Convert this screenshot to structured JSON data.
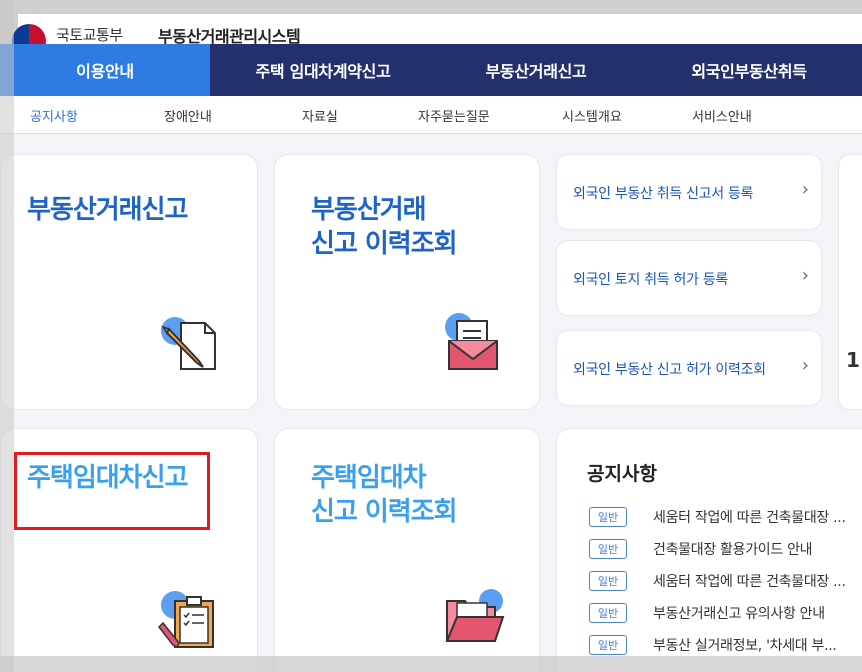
{
  "header": {
    "ministry": "국토교통부",
    "system_name": "부동산거래관리시스템"
  },
  "main_nav": [
    {
      "label": "이용안내",
      "active": true
    },
    {
      "label": "주택 임대차계약신고",
      "active": false
    },
    {
      "label": "부동산거래신고",
      "active": false
    },
    {
      "label": "외국인부동산취득",
      "active": false
    }
  ],
  "sub_nav": [
    {
      "label": "공지사항",
      "active": true
    },
    {
      "label": "장애안내",
      "active": false
    },
    {
      "label": "자료실",
      "active": false
    },
    {
      "label": "자주묻는질문",
      "active": false
    },
    {
      "label": "시스템개요",
      "active": false
    },
    {
      "label": "서비스안내",
      "active": false
    }
  ],
  "cards": {
    "real_estate_report": {
      "title": "부동산거래신고",
      "icon": "document-pencil-icon"
    },
    "real_estate_history": {
      "title": "부동산거래\n신고 이력조회",
      "icon": "mail-document-icon"
    },
    "housing_lease_report": {
      "title": "주택임대차신고",
      "icon": "clipboard-checklist-icon"
    },
    "housing_lease_history": {
      "title": "주택임대차\n신고 이력조회",
      "icon": "folder-open-icon"
    }
  },
  "quick_links": [
    {
      "label": "외국인 부동산 취득 신고서 등록",
      "chevron": "›"
    },
    {
      "label": "외국인 토지 취득 허가 등록",
      "chevron": "›"
    },
    {
      "label": "외국인 부동산 신고 허가 이력조회",
      "chevron": "›"
    }
  ],
  "notices": {
    "title": "공지사항",
    "items": [
      {
        "badge": "일반",
        "text": "세움터 작업에 따른 건축물대장 ..."
      },
      {
        "badge": "일반",
        "text": "건축물대장 활용가이드 안내"
      },
      {
        "badge": "일반",
        "text": "세움터 작업에 따른 건축물대장 ..."
      },
      {
        "badge": "일반",
        "text": "부동산거래신고 유의사항 안내"
      },
      {
        "badge": "일반",
        "text": "부동산 실거래정보, '차세대 부..."
      }
    ]
  },
  "side_panel": {
    "number": "1"
  },
  "colors": {
    "nav_bg": "#23306b",
    "nav_active": "#2f7be4",
    "title_dark_blue": "#1e63c8",
    "title_light_blue": "#3aa0ec",
    "highlight_red": "#e11b22"
  }
}
